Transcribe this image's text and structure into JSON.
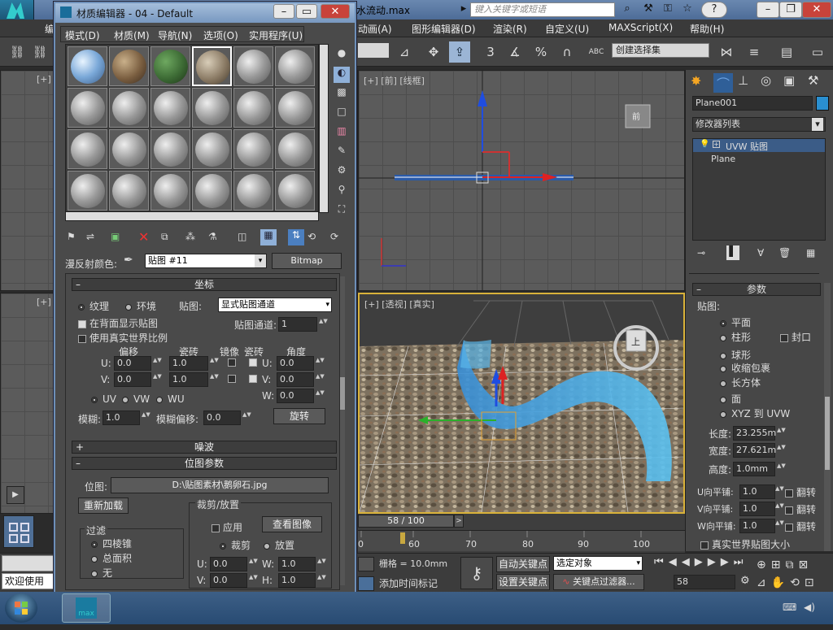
{
  "max_window": {
    "filename": "水流动.max",
    "search_placeholder": "键入关键字或短语",
    "help_glyph": "?"
  },
  "main_menu": [
    {
      "label": "编"
    },
    {
      "label": "动画(A)"
    },
    {
      "label": "图形编辑器(D)"
    },
    {
      "label": "渲染(R)"
    },
    {
      "label": "自定义(U)"
    },
    {
      "label": "MAXScript(X)"
    },
    {
      "label": "帮助(H)"
    }
  ],
  "toolbar": {
    "selection_set": "创建选择集",
    "snap_numbers": [
      "3",
      "%"
    ],
    "abc": "ABC"
  },
  "viewports": {
    "front_label": "[+] [前] [线框]",
    "top_left_label": "[+]",
    "bottom_left_label": "[+]",
    "persp_label": "[+] [透视] [真实]",
    "viewcube_front": "前",
    "viewcube_top": "上"
  },
  "command_panel": {
    "object_name": "Plane001",
    "modifier_list": "修改器列表",
    "stack": [
      {
        "label": "UVW 贴图"
      },
      {
        "label": "Plane"
      }
    ],
    "params_title": "参数",
    "mapping_label": "贴图:",
    "mapping_options": [
      {
        "label": "平面",
        "selected": true
      },
      {
        "label": "柱形",
        "selected": false
      },
      {
        "label": "球形",
        "selected": false
      },
      {
        "label": "收缩包裹",
        "selected": false
      },
      {
        "label": "长方体",
        "selected": false
      },
      {
        "label": "面",
        "selected": false
      },
      {
        "label": "XYZ 到 UVW",
        "selected": false
      }
    ],
    "cap_label": "封口",
    "length_label": "长度:",
    "length_value": "23.255m",
    "width_label": "宽度:",
    "width_value": "27.621m",
    "height_label": "高度:",
    "height_value": "1.0mm",
    "u_tile_label": "U向平铺:",
    "u_tile_value": "1.0",
    "v_tile_label": "V向平铺:",
    "v_tile_value": "1.0",
    "w_tile_label": "W向平铺:",
    "w_tile_value": "1.0",
    "flip_label": "翻转",
    "real_world_label": "真实世界贴图大小"
  },
  "material_editor": {
    "title": "材质编辑器 - 04 - Default",
    "menu": [
      "模式(D)",
      "材质(M)",
      "导航(N)",
      "选项(O)",
      "实用程序(U)"
    ],
    "diffuse_label": "漫反射颜色:",
    "map_name": "贴图 #11",
    "map_type": "Bitmap",
    "coords_title": "坐标",
    "texture_label": "纹理",
    "environ_label": "环境",
    "mapping_label": "贴图:",
    "mapping_value": "显式贴图通道",
    "show_back_label": "在背面显示贴图",
    "real_world_label": "使用真实世界比例",
    "map_channel_label": "贴图通道:",
    "map_channel_value": "1",
    "offset_label": "偏移",
    "tiling_label": "瓷砖",
    "mirror_label": "镜像",
    "tile_label": "瓷砖",
    "angle_label": "角度",
    "u_label": "U:",
    "v_label": "V:",
    "w_label": "W:",
    "u_offset": "0.0",
    "v_offset": "0.0",
    "u_tiling": "1.0",
    "v_tiling": "1.0",
    "u_angle": "0.0",
    "v_angle": "0.0",
    "w_angle": "0.0",
    "uv_label": "UV",
    "vw_label": "VW",
    "wu_label": "WU",
    "blur_label": "模糊:",
    "blur_value": "1.0",
    "blur_offset_label": "模糊偏移:",
    "blur_offset_value": "0.0",
    "rotate_label": "旋转",
    "noise_title": "噪波",
    "bitmap_params_title": "位图参数",
    "bitmap_label": "位图:",
    "bitmap_path": "D:\\贴图素材\\鹅卵石.jpg",
    "reload_label": "重新加载",
    "crop_title": "裁剪/放置",
    "apply_label": "应用",
    "view_image_label": "查看图像",
    "filter_title": "过滤",
    "filter_options": [
      {
        "label": "四棱锥",
        "selected": true
      },
      {
        "label": "总面积",
        "selected": false
      },
      {
        "label": "无",
        "selected": false
      }
    ],
    "crop_label": "裁剪",
    "place_label": "放置",
    "crop_u_label": "U:",
    "crop_u": "0.0",
    "crop_v_label": "V:",
    "crop_v": "0.0",
    "crop_w_label": "W:",
    "crop_w": "1.0",
    "crop_h_label": "H:",
    "crop_h": "1.0"
  },
  "timeline": {
    "frame_display": "58 / 100",
    "ticks": [
      "0",
      "60",
      "70",
      "80",
      "90",
      "100"
    ]
  },
  "status_bar": {
    "welcome": "欢迎使用",
    "grid_label": "栅格 = 10.0mm",
    "add_time_tag": "添加时间标记",
    "auto_key": "自动关键点",
    "set_key": "设置关键点",
    "selected_object": "选定对象",
    "key_filters": "关键点过滤器...",
    "frame_value": "58"
  },
  "colors": {
    "accent_blue": "#3a7bd5",
    "water": "#2f9de0"
  }
}
